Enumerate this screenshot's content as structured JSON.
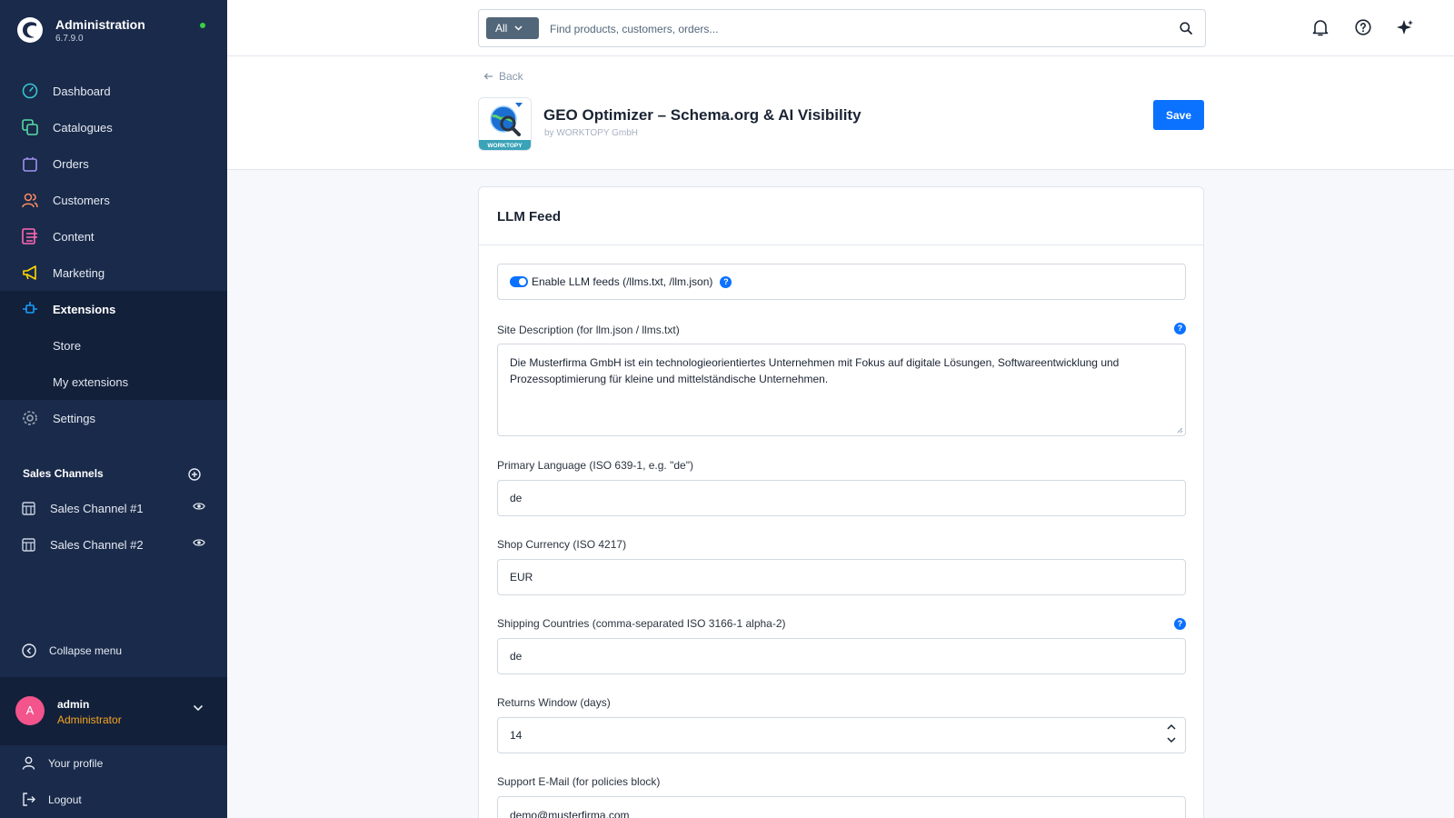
{
  "sidebar": {
    "app_title": "Administration",
    "version": "6.7.9.0",
    "nav": [
      {
        "label": "Dashboard",
        "icon": "dashboard-icon",
        "color": "#37c6d0"
      },
      {
        "label": "Catalogues",
        "icon": "catalogue-icon",
        "color": "#57d9a3"
      },
      {
        "label": "Orders",
        "icon": "orders-icon",
        "color": "#a092f0"
      },
      {
        "label": "Customers",
        "icon": "customers-icon",
        "color": "#f88962"
      },
      {
        "label": "Content",
        "icon": "content-icon",
        "color": "#ff68b4"
      },
      {
        "label": "Marketing",
        "icon": "marketing-icon",
        "color": "#ffd700"
      },
      {
        "label": "Extensions",
        "icon": "extensions-icon",
        "color": "#189eff"
      },
      {
        "label": "Store",
        "icon": ""
      },
      {
        "label": "My extensions",
        "icon": ""
      },
      {
        "label": "Settings",
        "icon": "settings-icon",
        "color": "#9aa8b5"
      }
    ],
    "sales_channels_title": "Sales Channels",
    "sales_channels": [
      {
        "label": "Sales Channel #1"
      },
      {
        "label": "Sales Channel #2"
      }
    ],
    "collapse_label": "Collapse menu",
    "user": {
      "initial": "A",
      "name": "admin",
      "role": "Administrator"
    },
    "profile_label": "Your profile",
    "logout_label": "Logout"
  },
  "topbar": {
    "search_type": "All",
    "search_placeholder": "Find products, customers, orders..."
  },
  "header": {
    "back_label": "Back",
    "title": "GEO Optimizer – Schema.org & AI Visibility",
    "by": "by WORKTOPY GmbH",
    "logo_text": "WORKTOPY",
    "save_label": "Save"
  },
  "card": {
    "title": "LLM Feed",
    "toggle_label": "Enable LLM feeds (/llms.txt, /llm.json)",
    "toggle_on": true,
    "site_description_label": "Site Description (for llm.json / llms.txt)",
    "site_description_value": "Die Musterfirma GmbH ist ein technologieorientiertes Unternehmen mit Fokus auf digitale Lösungen, Softwareentwicklung und Prozessoptimierung für kleine und mittelständische Unternehmen.",
    "primary_language_label": "Primary Language (ISO 639-1, e.g. \"de\")",
    "primary_language_value": "de",
    "currency_label": "Shop Currency (ISO 4217)",
    "currency_value": "EUR",
    "shipping_label": "Shipping Countries (comma-separated ISO 3166-1 alpha-2)",
    "shipping_value": "de",
    "returns_label": "Returns Window (days)",
    "returns_value": "14",
    "email_label": "Support E-Mail (for policies block)",
    "email_value": "demo@musterfirma.com",
    "help_glyph": "?"
  },
  "colors": {
    "sidebar_bg": "#1a2a4a",
    "accent": "#0b71ff",
    "role": "#f6a623",
    "status_online": "#37d046"
  }
}
